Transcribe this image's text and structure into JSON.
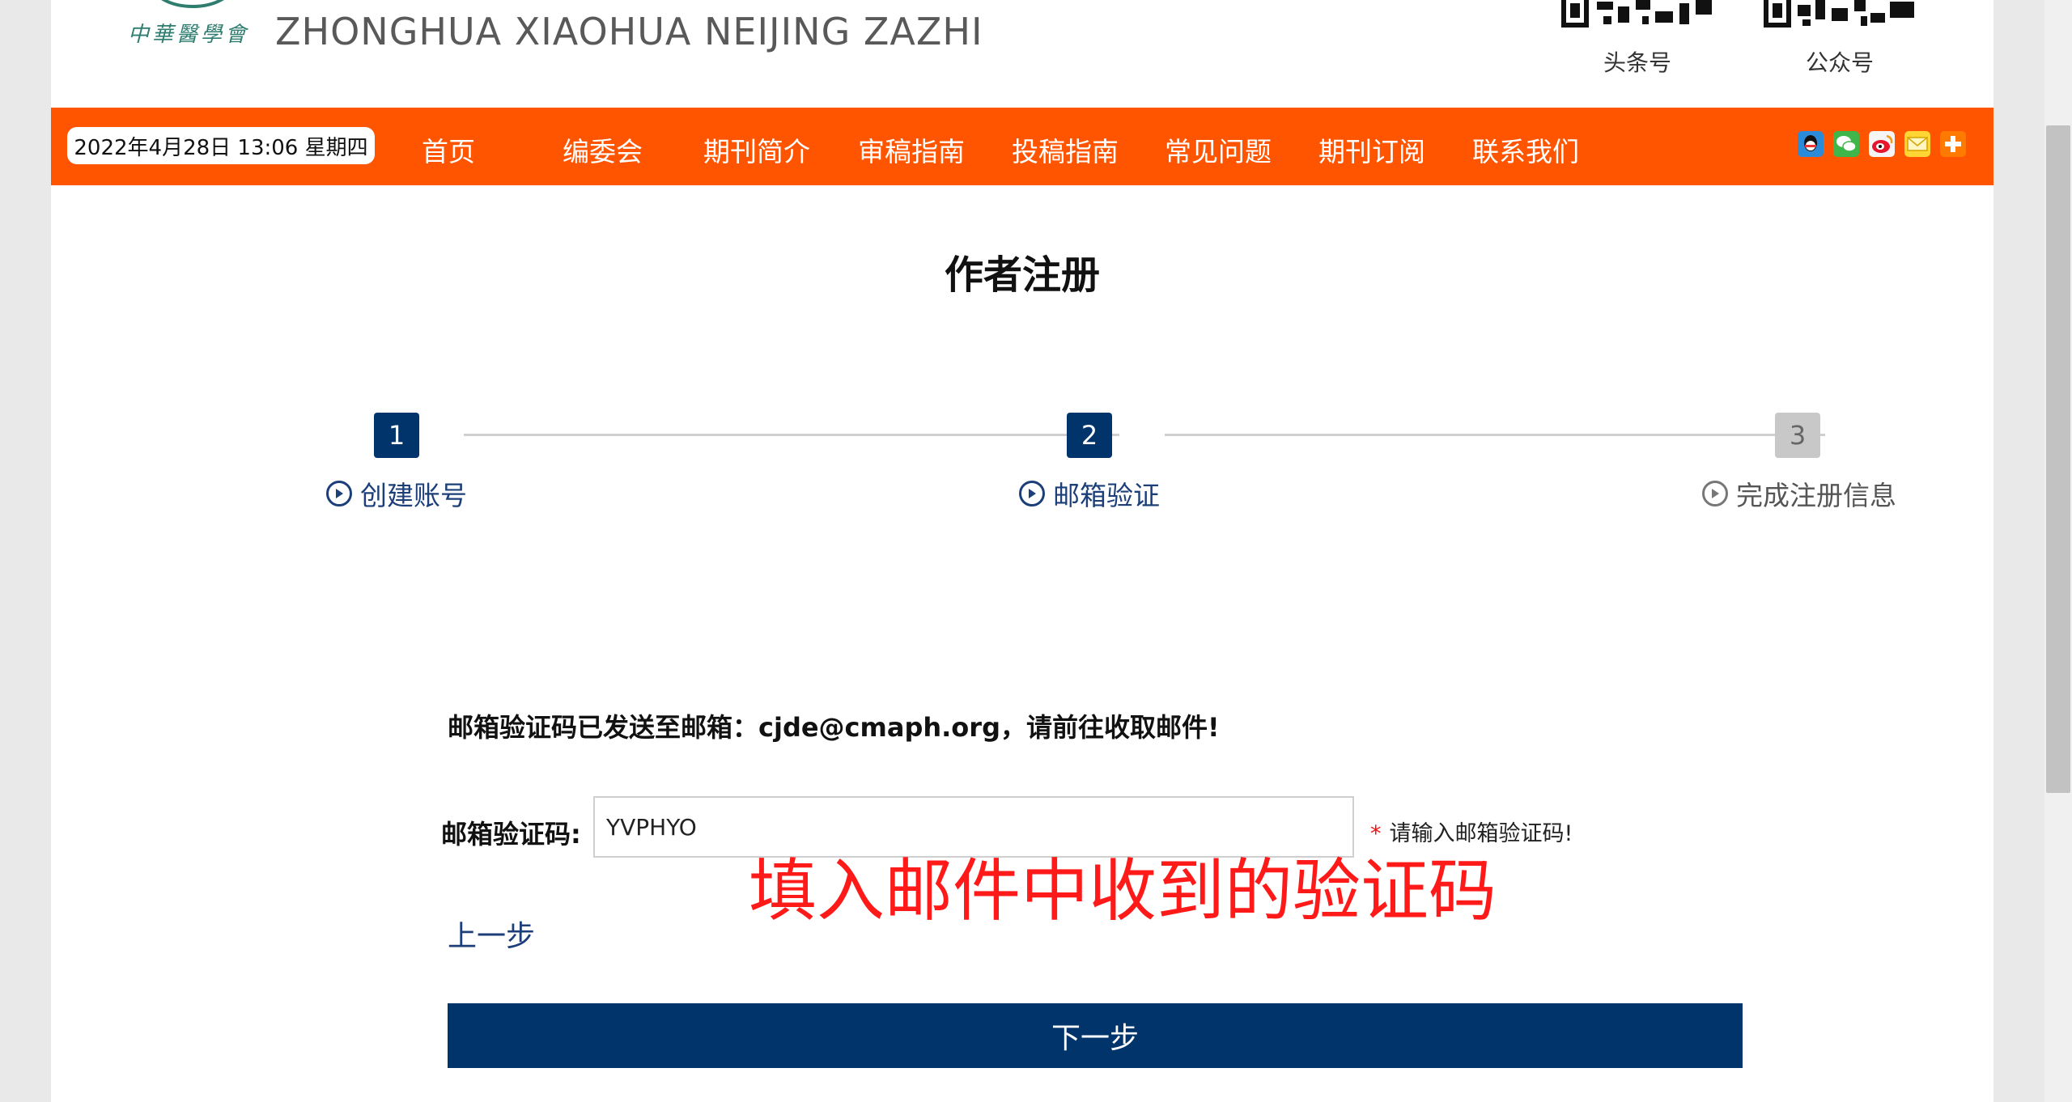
{
  "header": {
    "emblem_text": "中華醫學會",
    "journal_name_latin": "ZHONGHUA XIAOHUA NEIJING ZAZHI",
    "qr_codes": [
      {
        "label": "头条号"
      },
      {
        "label": "公众号"
      }
    ]
  },
  "nav": {
    "datetime": "2022年4月28日 13:06 星期四",
    "items": [
      "首页",
      "编委会",
      "期刊简介",
      "审稿指南",
      "投稿指南",
      "常见问题",
      "期刊订阅",
      "联系我们"
    ],
    "share_icons": [
      "qq-icon",
      "wechat-icon",
      "weibo-icon",
      "email-icon",
      "plus-icon"
    ]
  },
  "page": {
    "title": "作者注册"
  },
  "steps": [
    {
      "number": "1",
      "label": "创建账号",
      "state": "done"
    },
    {
      "number": "2",
      "label": "邮箱验证",
      "state": "active"
    },
    {
      "number": "3",
      "label": "完成注册信息",
      "state": "pending"
    }
  ],
  "form": {
    "sent_message": "邮箱验证码已发送至邮箱：cjde@cmaph.org，请前往收取邮件!",
    "code_label": "邮箱验证码:",
    "code_value": "YVPHYO",
    "hint": "请输入邮箱验证码!",
    "prev_label": "上一步",
    "next_label": "下一步"
  },
  "annotation": "填入邮件中收到的验证码",
  "colors": {
    "nav_bg": "#ff5500",
    "step_active": "#00346b",
    "step_pending": "#c8c8c8",
    "annotation": "#ff1a1a"
  }
}
